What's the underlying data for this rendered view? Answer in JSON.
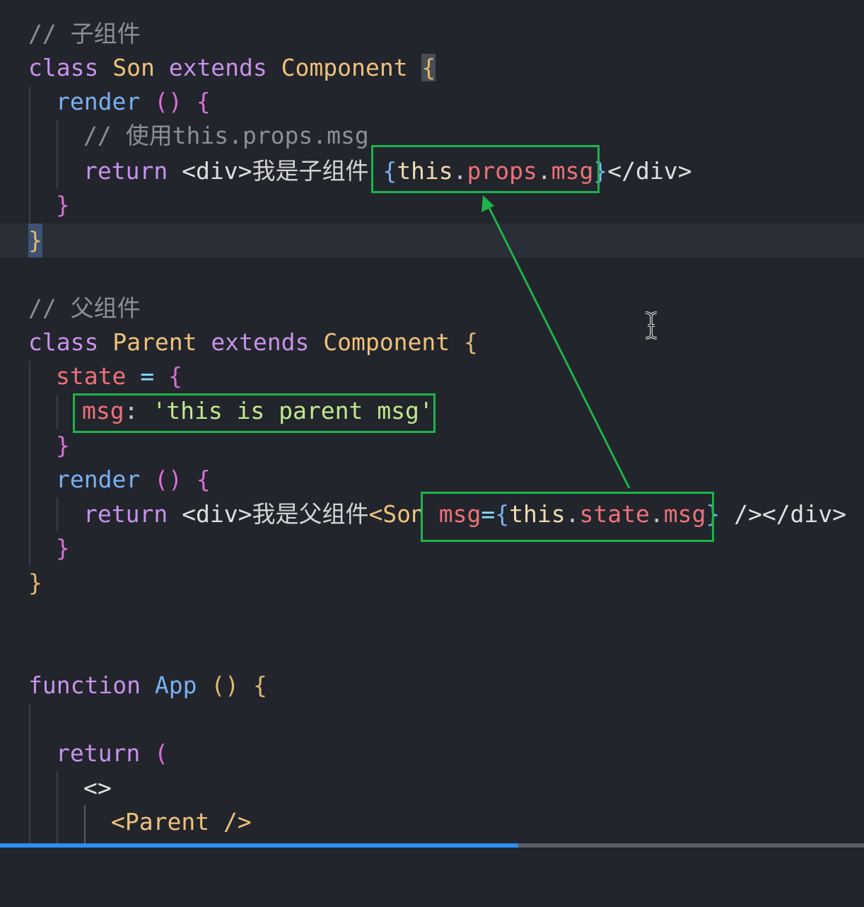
{
  "code": {
    "son_comment": "// 子组件",
    "son_class_kw": "class",
    "son_class_name": "Son",
    "son_extends_kw": "extends",
    "son_base": "Component",
    "son_render": "render",
    "son_render_comment": "// 使用this.props.msg",
    "son_return_kw": "return",
    "son_return_open_tag": "<div>",
    "son_return_text": "我是子组件 ",
    "son_return_expr_this": "this",
    "son_return_expr_props": "props",
    "son_return_expr_msg": "msg",
    "son_return_close_tag": "</div>",
    "parent_comment": "// 父组件",
    "parent_class_kw": "class",
    "parent_class_name": "Parent",
    "parent_extends_kw": "extends",
    "parent_base": "Component",
    "state_kw": "state",
    "state_prop": "msg",
    "state_value": "'this is parent msg'",
    "parent_render": "render",
    "parent_return_kw": "return",
    "parent_return_open_tag": "<div>",
    "parent_return_text": "我是父组件",
    "parent_son_tag": "<Son",
    "parent_son_attr": "msg",
    "parent_son_expr_this": "this",
    "parent_son_expr_state": "state",
    "parent_son_expr_msg": "msg",
    "parent_son_tail": " /></div>",
    "app_kw": "function",
    "app_name": "App",
    "app_return_kw": "return",
    "fragment_open": "<>",
    "parent_usage": "<Parent />"
  },
  "colors": {
    "annotation_box": "#1db34a",
    "annotation_arrow": "#1db34a",
    "background": "#22252c",
    "progress": "#2d8ef0"
  },
  "video_progress": 0.6
}
